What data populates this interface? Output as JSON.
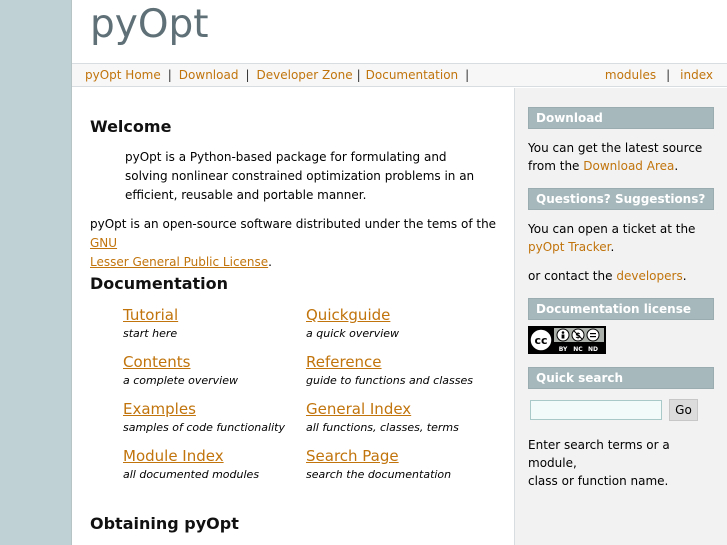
{
  "header": {
    "logo": "pyOpt"
  },
  "nav": {
    "left": [
      "pyOpt Home",
      "Download",
      "Developer Zone",
      "Documentation"
    ],
    "right": [
      "modules",
      "index"
    ]
  },
  "main": {
    "welcome": {
      "heading": "Welcome",
      "intro_lines": [
        "pyOpt is a Python-based package for formulating and",
        "solving nonlinear constrained optimization problems in an",
        "efficient, reusable and portable manner."
      ],
      "license_text": "pyOpt is an open-source software distributed under the tems of the",
      "license_link_1": "GNU",
      "license_link_2": "Lesser General Public License",
      "license_end": "."
    },
    "documentation": {
      "heading": "Documentation",
      "items": [
        {
          "title": "Tutorial",
          "desc": "start here"
        },
        {
          "title": "Quickguide",
          "desc": "a quick overview"
        },
        {
          "title": "Contents",
          "desc": "a complete overview"
        },
        {
          "title": "Reference",
          "desc": "guide to functions and classes"
        },
        {
          "title": "Examples",
          "desc": "samples of code functionality"
        },
        {
          "title": "General Index",
          "desc": "all functions, classes, terms"
        },
        {
          "title": "Module Index",
          "desc": "all documented modules"
        },
        {
          "title": "Search Page",
          "desc": "search the documentation"
        }
      ]
    },
    "obtaining": {
      "heading": "Obtaining pyOpt"
    }
  },
  "sidebar": {
    "download": {
      "heading": "Download",
      "text_1": "You can get the latest source",
      "text_2": "from the",
      "link": "Download Area",
      "end": "."
    },
    "questions": {
      "heading": "Questions? Suggestions?",
      "text_1": "You can open a ticket at the",
      "link": "pyOpt Tracker",
      "end": ".",
      "contact_text": "or contact the",
      "contact_link": "developers",
      "contact_end": "."
    },
    "license": {
      "heading": "Documentation license",
      "badge_labels": [
        "BY",
        "NC",
        "ND"
      ]
    },
    "search": {
      "heading": "Quick search",
      "button": "Go",
      "input_value": "",
      "help_1": "Enter search terms or a module,",
      "help_2": "class or function name."
    }
  },
  "colors": {
    "background": "#bfd1d4",
    "link": "#c1740c",
    "sidebar_heading": "#a6b8bc",
    "logo": "#5f7077"
  }
}
